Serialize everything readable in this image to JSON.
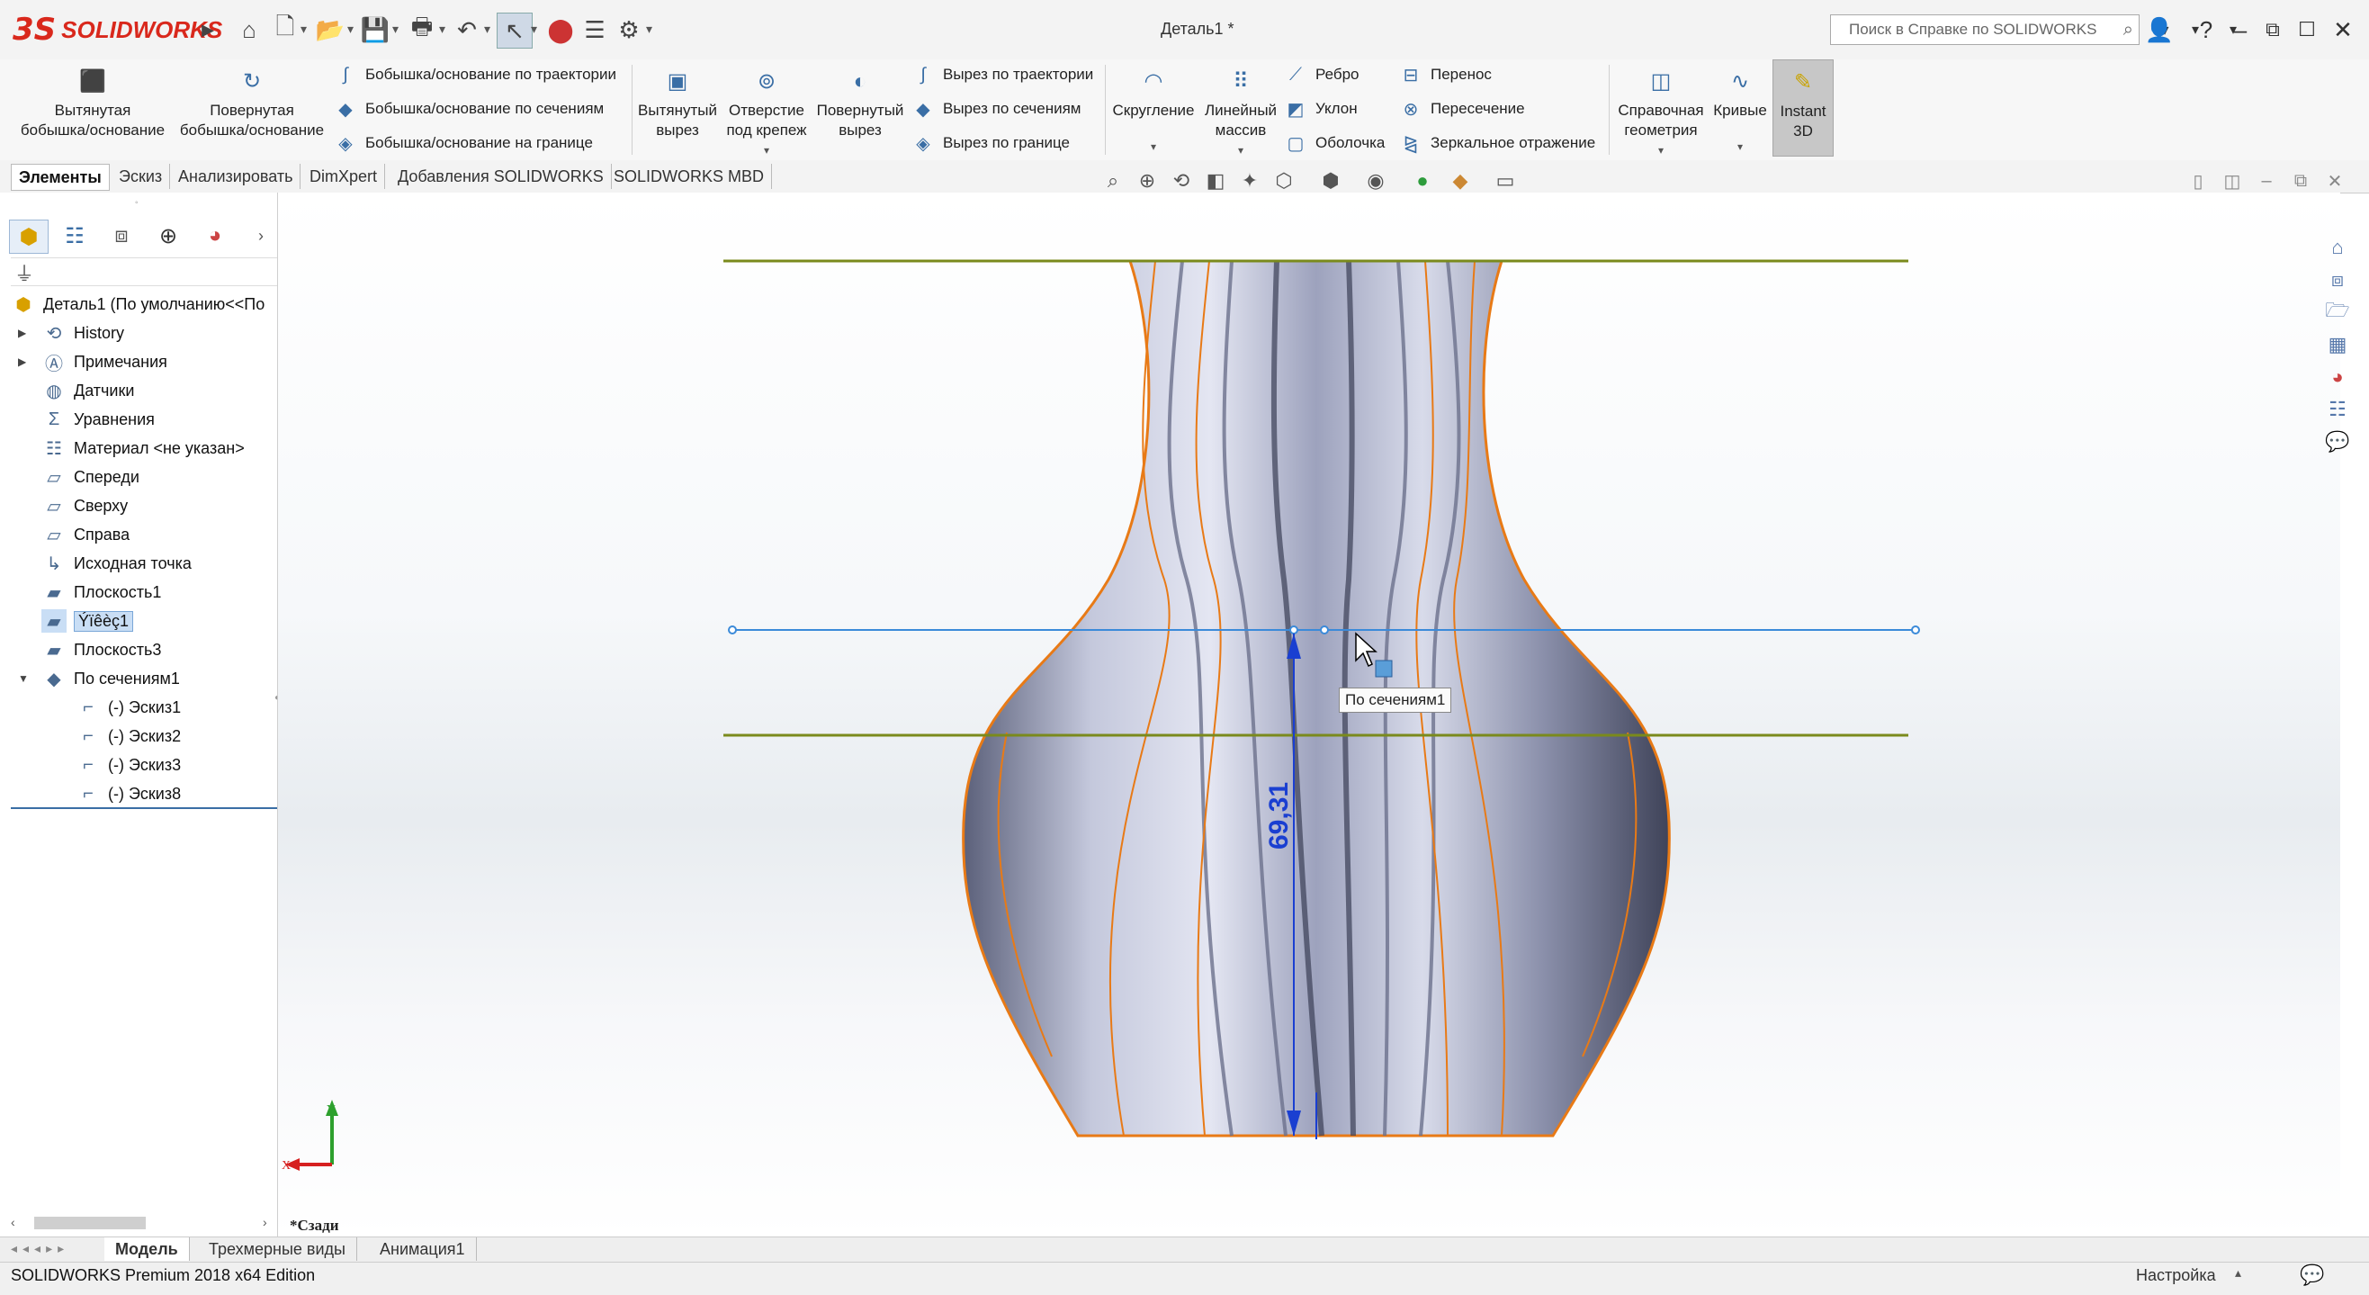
{
  "app": {
    "brand_ds": "3S",
    "brand_name": "SOLIDWORKS",
    "doc_title": "Деталь1 *"
  },
  "help_search": {
    "placeholder": "Поиск в Справке по SOLIDWORKS"
  },
  "ribbon": {
    "extruded_boss": "Вытянутая\nбобышка/основание",
    "revolved_boss": "Повернутая\nбобышка/основание",
    "swept_boss": "Бобышка/основание по траектории",
    "lofted_boss": "Бобышка/основание по сечениям",
    "boundary_boss": "Бобышка/основание на границе",
    "extruded_cut": "Вытянутый\nвырез",
    "hole_wizard": "Отверстие\nпод крепеж",
    "revolved_cut": "Повернутый\nвырез",
    "swept_cut": "Вырез по траектории",
    "lofted_cut": "Вырез по сечениям",
    "boundary_cut": "Вырез по границе",
    "fillet": "Скругление",
    "linear_pattern": "Линейный\nмассив",
    "rib": "Ребро",
    "draft": "Уклон",
    "shell": "Оболочка",
    "wrap": "Перенос",
    "intersect": "Пересечение",
    "mirror": "Зеркальное отражение",
    "ref_geometry": "Справочная\nгеометрия",
    "curves": "Кривые",
    "instant3d": "Instant\n3D"
  },
  "tabs": [
    "Элементы",
    "Эскиз",
    "Анализировать",
    "DimXpert",
    "Добавления SOLIDWORKS",
    "SOLIDWORKS MBD"
  ],
  "tree": {
    "root": "Деталь1  (По умолчанию<<По",
    "items": [
      {
        "label": "History",
        "icon": "history-icon"
      },
      {
        "label": "Примечания",
        "icon": "annotations-icon"
      },
      {
        "label": "Датчики",
        "icon": "sensors-icon"
      },
      {
        "label": "Уравнения",
        "icon": "equations-icon"
      },
      {
        "label": "Материал <не указан>",
        "icon": "material-icon"
      },
      {
        "label": "Спереди",
        "icon": "plane-icon"
      },
      {
        "label": "Сверху",
        "icon": "plane-icon"
      },
      {
        "label": "Справа",
        "icon": "plane-icon"
      },
      {
        "label": "Исходная точка",
        "icon": "origin-icon"
      },
      {
        "label": "Плоскость1",
        "icon": "plane-icon"
      },
      {
        "label": "Ýïêèç1",
        "icon": "plane-icon"
      },
      {
        "label": "Плоскость3",
        "icon": "plane-icon"
      },
      {
        "label": "По сечениям1",
        "icon": "loft-icon"
      },
      {
        "label": "(-) Эскиз1",
        "icon": "sketch-icon"
      },
      {
        "label": "(-) Эскиз2",
        "icon": "sketch-icon"
      },
      {
        "label": "(-) Эскиз3",
        "icon": "sketch-icon"
      },
      {
        "label": "(-) Эскиз8",
        "icon": "sketch-icon"
      }
    ]
  },
  "viewport": {
    "dimension": "69,31",
    "tooltip": "По сечениям1",
    "view_name": "*Сзади",
    "axis_x": "X",
    "axis_y": "Y"
  },
  "bottom_tabs": [
    "Модель",
    "Трехмерные виды",
    "Анимация1"
  ],
  "status": {
    "text": "SOLIDWORKS Premium 2018 x64 Edition",
    "right": "Настройка"
  },
  "colors": {
    "accent": "#d9281c",
    "dimension": "#1a3fd1",
    "edges": "#e87a16",
    "plane": "#7a8a1c",
    "sketch_line": "#3b8ad9"
  }
}
